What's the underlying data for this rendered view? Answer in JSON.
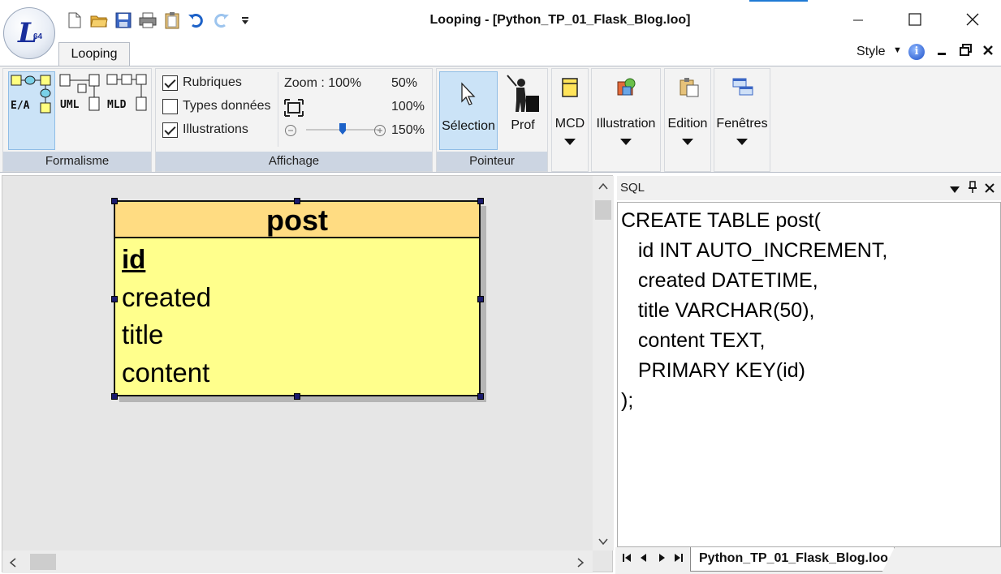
{
  "window": {
    "title": "Looping - [Python_TP_01_Flask_Blog.loo]",
    "logo_text": "L",
    "logo_sub": "64"
  },
  "quick_access": [
    "new-file-icon",
    "open-folder-icon",
    "save-icon",
    "print-icon",
    "clipboard-icon",
    "undo-icon",
    "redo-icon",
    "customize-toolbar-icon"
  ],
  "ribbon": {
    "tab": "Looping",
    "style_menu": "Style",
    "groups": {
      "formalisme": {
        "caption": "Formalisme",
        "buttons": [
          "E/A",
          "UML",
          "MLD"
        ]
      },
      "affichage": {
        "caption": "Affichage",
        "checkboxes": [
          {
            "label": "Rubriques",
            "checked": true
          },
          {
            "label": "Types données",
            "checked": false
          },
          {
            "label": "Illustrations",
            "checked": true
          }
        ],
        "zoom_label": "Zoom : 100%",
        "zoom_presets": [
          "50%",
          "100%",
          "150%"
        ],
        "zoom_level_percent": 100
      },
      "pointeur": {
        "caption": "Pointeur",
        "selection": "Sélection",
        "prof": "Prof"
      },
      "menus": [
        "MCD",
        "Illustration",
        "Edition",
        "Fenêtres"
      ]
    }
  },
  "entity": {
    "name": "post",
    "attributes": [
      {
        "name": "id",
        "key": true
      },
      {
        "name": "created",
        "key": false
      },
      {
        "name": "title",
        "key": false
      },
      {
        "name": "content",
        "key": false
      }
    ]
  },
  "sql_pane": {
    "title": "SQL",
    "lines": [
      "CREATE TABLE post(",
      "   id INT AUTO_INCREMENT,",
      "   created DATETIME,",
      "   title VARCHAR(50),",
      "   content TEXT,",
      "   PRIMARY KEY(id)",
      ");"
    ]
  },
  "doc_tabs": {
    "active": "Python_TP_01_Flask_Blog.loo"
  },
  "colors": {
    "entity_header": "#ffdc82",
    "entity_body": "#ffff8c",
    "ribbon_caption": "#ccd5e2",
    "selection_highlight": "#cbe3f7"
  }
}
